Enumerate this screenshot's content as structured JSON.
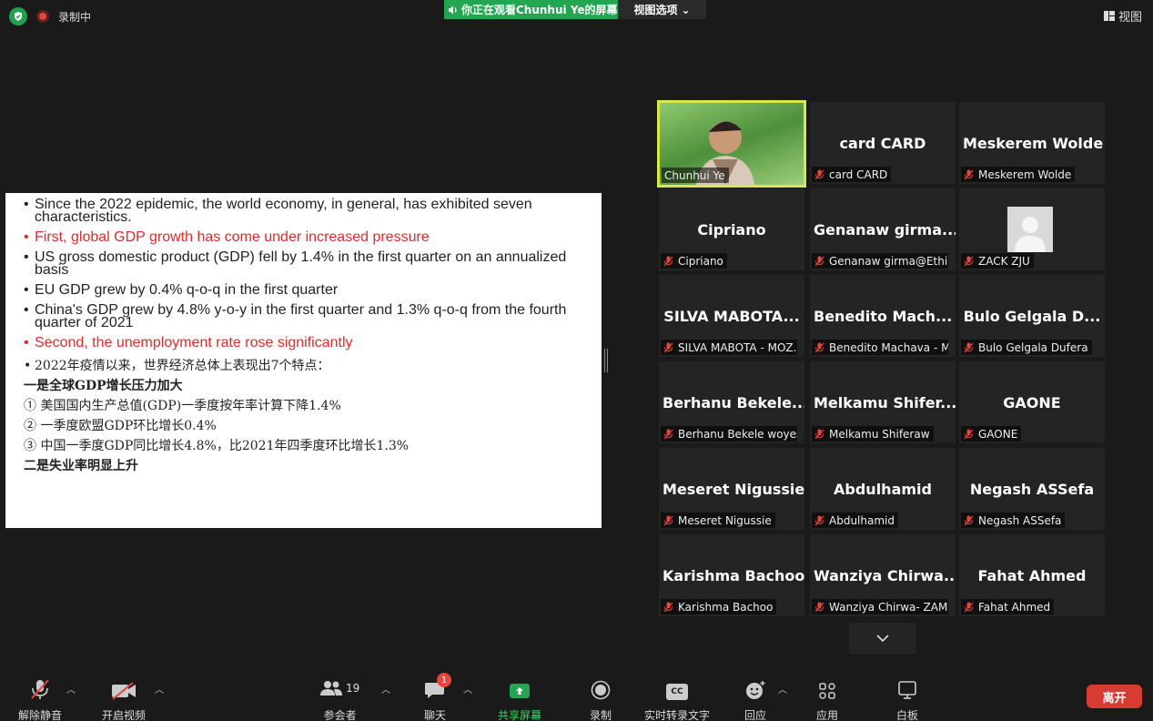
{
  "top": {
    "recording_label": "录制中",
    "viewing_banner": "你正在观看Chunhui Ye的屏幕",
    "view_options": "视图选项",
    "view_button": "视图"
  },
  "slide": {
    "en": [
      {
        "text": "Since the 2022 epidemic, the world economy, in general, has exhibited seven characteristics.",
        "red": false
      },
      {
        "text": "First, global GDP growth has come under increased pressure",
        "red": true
      },
      {
        "text": "US gross domestic product (GDP) fell by 1.4% in the first quarter on an annualized basis",
        "red": false
      },
      {
        "text": "EU GDP grew by 0.4% q-o-q in the first quarter",
        "red": false
      },
      {
        "text": "China's GDP grew by 4.8% y-o-y in the first quarter and 1.3% q-o-q from the fourth quarter of 2021",
        "red": false
      },
      {
        "text": "Second, the unemployment rate rose significantly",
        "red": true
      }
    ],
    "cn_bullet": "2022年疫情以来，世界经济总体上表现出7个特点：",
    "cn_heading1": "一是全球GDP增长压力加大",
    "cn_items": [
      "①  美国国内生产总值(GDP)一季度按年率计算下降1.4%",
      "②  一季度欧盟GDP环比增长0.4%",
      "③  中国一季度GDP同比增长4.8%，比2021年四季度环比增长1.3%"
    ],
    "cn_heading2": "二是失业率明显上升"
  },
  "participants": [
    {
      "big": "",
      "name": "Chunhui Ye",
      "type": "video"
    },
    {
      "big": "card CARD",
      "name": "card CARD",
      "type": "name"
    },
    {
      "big": "Meskerem Wolde",
      "name": "Meskerem Wolde",
      "type": "name"
    },
    {
      "big": "Cipriano",
      "name": "Cipriano",
      "type": "name"
    },
    {
      "big": "Genanaw  girma...",
      "name": "Genanaw girma@Ethi...",
      "type": "name"
    },
    {
      "big": "",
      "name": "ZACK ZJU",
      "type": "avatar"
    },
    {
      "big": "SILVA  MABOTA...",
      "name": "SILVA MABOTA - MOZ...",
      "type": "name"
    },
    {
      "big": "Benedito  Mach...",
      "name": "Benedito Machava - M...",
      "type": "name"
    },
    {
      "big": "Bulo Gelgala D...",
      "name": "Bulo Gelgala Dufera",
      "type": "name"
    },
    {
      "big": "Berhanu  Bekele...",
      "name": "Berhanu Bekele woyes...",
      "type": "name"
    },
    {
      "big": "Melkamu  Shifer...",
      "name": "Melkamu Shiferaw",
      "type": "name"
    },
    {
      "big": "GAONE",
      "name": "GAONE",
      "type": "name"
    },
    {
      "big": "Meseret Nigussie",
      "name": "Meseret Nigussie",
      "type": "name"
    },
    {
      "big": "Abdulhamid",
      "name": "Abdulhamid",
      "type": "name"
    },
    {
      "big": "Negash ASSefa",
      "name": "Negash ASSefa",
      "type": "name"
    },
    {
      "big": "Karishma Bachoo",
      "name": "Karishma Bachoo",
      "type": "name"
    },
    {
      "big": "Wanziya  Chirwa...",
      "name": "Wanziya Chirwa- ZAM...",
      "type": "name"
    },
    {
      "big": "Fahat Ahmed",
      "name": "Fahat Ahmed",
      "type": "name"
    }
  ],
  "toolbar": {
    "unmute": "解除静音",
    "start_video": "开启视频",
    "participants": "参会者",
    "participants_count": "19",
    "chat": "聊天",
    "chat_badge": "1",
    "share": "共享屏幕",
    "record": "录制",
    "captions": "实时转录文字",
    "captions_icon_text": "CC",
    "reactions": "回应",
    "apps": "应用",
    "whiteboard": "白板",
    "leave": "离开"
  },
  "colors": {
    "share_green": "#23a652",
    "active_speaker": "#d7e84a",
    "leave_red": "#d73c33",
    "slide_red": "#e12b2b"
  }
}
